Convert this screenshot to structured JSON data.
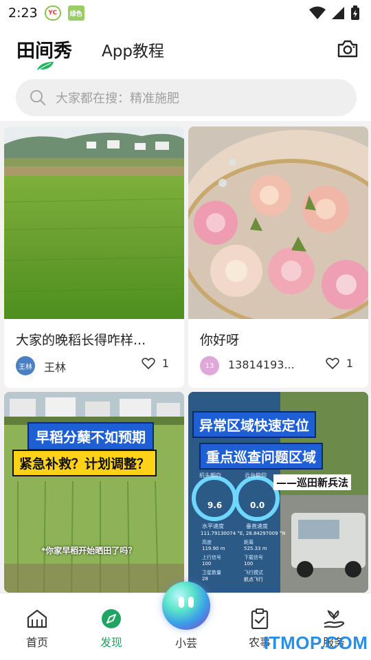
{
  "status_bar": {
    "time": "2:23",
    "app_badges": [
      "YC",
      "绿色"
    ]
  },
  "header": {
    "tab_main": "田间秀",
    "tab_second": "App教程",
    "camera_icon": "camera-icon"
  },
  "search": {
    "placeholder": "大家都在搜：精准施肥"
  },
  "feed": [
    {
      "title": "大家的晚稻长得咋样...",
      "author": "王林",
      "avatar_text": "王林",
      "avatar_color": "#4a7fc1",
      "likes": "1"
    },
    {
      "title": "你好呀",
      "author": "13814193...",
      "avatar_text": "13",
      "avatar_color": "#e0a8d8",
      "likes": "1"
    },
    {
      "overlay_line1": "早稻分蘖不如预期",
      "overlay_line2": "紧急补救？计划调整？",
      "caption": "*你家早稻开始晒田了吗？"
    },
    {
      "overlay_line1": "异常区域快速定位",
      "overlay_line2": "重点巡查问题区域",
      "overlay_line3": "——巡田新兵法",
      "coords": "111.79130074 °E, 28.84297009 °N",
      "gauge_left_label": "机头朝向",
      "gauge_left_value": "9.6",
      "gauge_left_sub": "水平速度",
      "gauge_right_label": "云台俯仰",
      "gauge_right_value": "0.0",
      "gauge_right_sub": "垂直速度",
      "stat_height_label": "高度",
      "stat_height_value": "119.90 m",
      "stat_dist_label": "距离",
      "stat_dist_value": "525.33 m",
      "stat_up_label": "上行信号",
      "stat_up_value": "100",
      "stat_down_label": "下载信号",
      "stat_down_value": "100",
      "stat_sat_label": "卫星数量",
      "stat_sat_value": "28",
      "stat_mode_label": "飞行模式",
      "stat_mode_value": "航点飞行"
    }
  ],
  "bottom_nav": {
    "items": [
      "首页",
      "发现",
      "小芸",
      "农事",
      "服务"
    ],
    "active": "发现",
    "accent_color": "#1fa463"
  },
  "watermark": "ITMOP.COM"
}
